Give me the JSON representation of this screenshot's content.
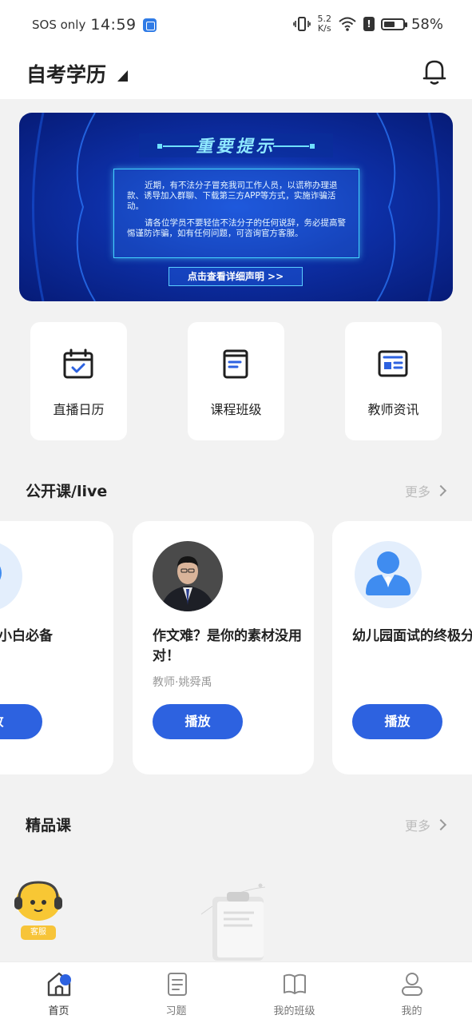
{
  "status_bar": {
    "network_text": "SOS only",
    "time": "14:59",
    "speed_value": "5.2",
    "speed_unit": "K/s",
    "battery_percent": "58%",
    "battery_level": 0.58
  },
  "header": {
    "title": "自考学历"
  },
  "banner": {
    "title": "重要提示",
    "paragraph1": "近期，有不法分子冒充我司工作人员，以谎称办理退款、诱导加入群聊、下载第三方APP等方式，实施诈骗活动。",
    "paragraph2": "请各位学员不要轻信不法分子的任何说辞，务必提高警惕谨防诈骗，如有任何问题，可咨询官方客服。",
    "button_label": "点击查看详细声明 >>"
  },
  "quick_entries": [
    {
      "label": "直播日历",
      "icon": "calendar-icon"
    },
    {
      "label": "课程班级",
      "icon": "book-icon"
    },
    {
      "label": "教师资讯",
      "icon": "news-icon"
    }
  ],
  "sections": {
    "open_class": {
      "title": "公开课/live",
      "more_label": "更多"
    },
    "premium": {
      "title": "精品课",
      "more_label": "更多"
    }
  },
  "courses": [
    {
      "title": "资考试-小白必备",
      "teacher": "",
      "play_label": "放"
    },
    {
      "title": "作文难？是你的素材没用对！",
      "teacher": "教师·姚舜禹",
      "play_label": "播放"
    },
    {
      "title": "幼儿园面试的终极分武器",
      "teacher": "",
      "play_label": "播放"
    }
  ],
  "support": {
    "label": "客服"
  },
  "tabbar": [
    {
      "label": "首页",
      "icon": "home-icon",
      "active": true
    },
    {
      "label": "习题",
      "icon": "exercise-icon",
      "active": false
    },
    {
      "label": "我的班级",
      "icon": "class-icon",
      "active": false
    },
    {
      "label": "我的",
      "icon": "profile-icon",
      "active": false
    }
  ],
  "colors": {
    "accent": "#2d62e0",
    "banner_dark": "#061b77",
    "banner_light": "#1a4fd8",
    "background": "#f2f2f2"
  }
}
